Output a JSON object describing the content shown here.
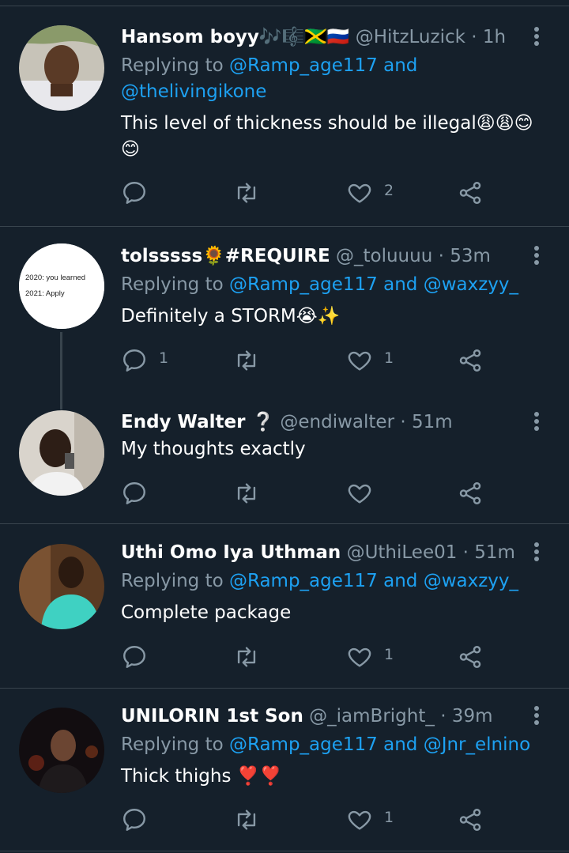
{
  "colors": {
    "background": "#15202b",
    "link": "#1da1f2",
    "muted": "#8899a6",
    "divider": "#38444d"
  },
  "tweets": [
    {
      "name": "Hansom boyy🎶🎼🇯🇲🇷🇺",
      "handle": "@HitzLuzick",
      "time": "· 1h",
      "reply_prefix": "Replying to ",
      "reply_mentions": "@Ramp_age117 and @thelivingikone",
      "text": "This level of thickness should be illegal😩😩😊😊",
      "replies": "",
      "retweets": "",
      "likes": "2"
    },
    {
      "name": "tolsssss🌻#REQUIRE",
      "handle": "@_toluuuu",
      "time": "· 53m",
      "reply_prefix": "Replying to ",
      "reply_mentions": "@Ramp_age117 and @waxzyy_",
      "text": "Definitely a STORM😭✨",
      "replies": "1",
      "retweets": "",
      "likes": "1",
      "avatar_text": [
        "2020: you learned",
        "2021: Apply"
      ]
    },
    {
      "name": "Endy Walter ❔",
      "handle": "@endiwalter",
      "time": "· 51m",
      "text": "My thoughts exactly",
      "replies": "",
      "retweets": "",
      "likes": ""
    },
    {
      "name": "Uthi Omo Iya Uthman",
      "handle": "@UthiLee01",
      "time": "· 51m",
      "reply_prefix": "Replying to ",
      "reply_mentions": "@Ramp_age117 and @waxzyy_",
      "text": "Complete package",
      "replies": "",
      "retweets": "",
      "likes": "1"
    },
    {
      "name": "UNILORIN 1st Son",
      "handle": "@_iamBright_",
      "time": "· 39m",
      "reply_prefix": "Replying to ",
      "reply_mentions": "@Ramp_age117 and @Jnr_elnino",
      "text": "Thick thighs ❣️❣️",
      "replies": "",
      "retweets": "",
      "likes": "1"
    }
  ],
  "icons": {
    "reply": "reply-icon",
    "retweet": "retweet-icon",
    "like": "heart-icon",
    "share": "share-icon",
    "more": "more-vertical-icon"
  }
}
